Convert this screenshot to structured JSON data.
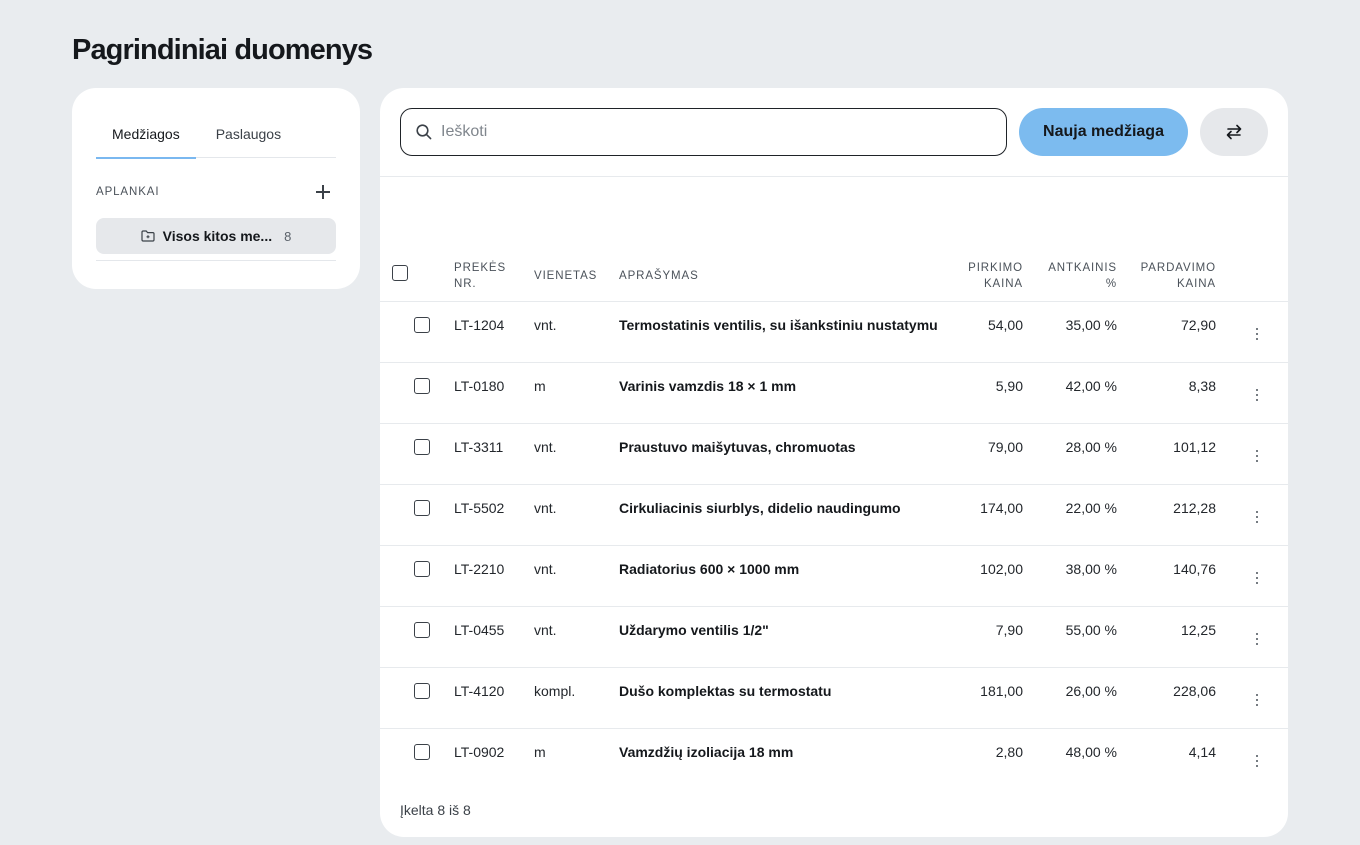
{
  "page": {
    "title": "Pagrindiniai duomenys"
  },
  "sidebar": {
    "tabs": [
      {
        "label": "Medžiagos",
        "active": true
      },
      {
        "label": "Paslaugos",
        "active": false
      }
    ],
    "folders_label": "APLANKAI",
    "folders": [
      {
        "name": "Visos kitos me...",
        "count": "8",
        "icon": "folder-icon"
      }
    ]
  },
  "toolbar": {
    "search_placeholder": "Ieškoti",
    "search_value": "",
    "new_button_label": "Nauja medžiaga",
    "swap_icon": "swap-arrows-icon"
  },
  "colors": {
    "accent": "#7cbbef",
    "background": "#e9ecef",
    "card": "#ffffff"
  },
  "table": {
    "headers": {
      "item_nr": [
        "PREKĖS",
        "NR."
      ],
      "unit": "VIENETAS",
      "description": "APRAŠYMAS",
      "purchase_price": [
        "PIRKIMO",
        "KAINA"
      ],
      "markup": [
        "ANTKAINIS",
        "%"
      ],
      "sale_price": [
        "PARDAVIMO",
        "KAINA"
      ]
    },
    "rows": [
      {
        "nr": "LT-1204",
        "unit": "vnt.",
        "desc": "Termostatinis ventilis, su išankstiniu nustatymu",
        "purchase": "54,00",
        "markup": "35,00 %",
        "sale": "72,90"
      },
      {
        "nr": "LT-0180",
        "unit": "m",
        "desc": "Varinis vamzdis 18 × 1 mm",
        "purchase": "5,90",
        "markup": "42,00 %",
        "sale": "8,38"
      },
      {
        "nr": "LT-3311",
        "unit": "vnt.",
        "desc": "Praustuvo maišytuvas, chromuotas",
        "purchase": "79,00",
        "markup": "28,00 %",
        "sale": "101,12"
      },
      {
        "nr": "LT-5502",
        "unit": "vnt.",
        "desc": "Cirkuliacinis siurblys, didelio naudingumo",
        "purchase": "174,00",
        "markup": "22,00 %",
        "sale": "212,28"
      },
      {
        "nr": "LT-2210",
        "unit": "vnt.",
        "desc": "Radiatorius 600 × 1000 mm",
        "purchase": "102,00",
        "markup": "38,00 %",
        "sale": "140,76"
      },
      {
        "nr": "LT-0455",
        "unit": "vnt.",
        "desc": "Uždarymo ventilis 1/2\"",
        "purchase": "7,90",
        "markup": "55,00 %",
        "sale": "12,25"
      },
      {
        "nr": "LT-4120",
        "unit": "kompl.",
        "desc": "Dušo komplektas su termostatu",
        "purchase": "181,00",
        "markup": "26,00 %",
        "sale": "228,06"
      },
      {
        "nr": "LT-0902",
        "unit": "m",
        "desc": "Vamzdžių izoliacija 18 mm",
        "purchase": "2,80",
        "markup": "48,00 %",
        "sale": "4,14"
      }
    ],
    "footer": "Įkelta 8 iš 8"
  }
}
